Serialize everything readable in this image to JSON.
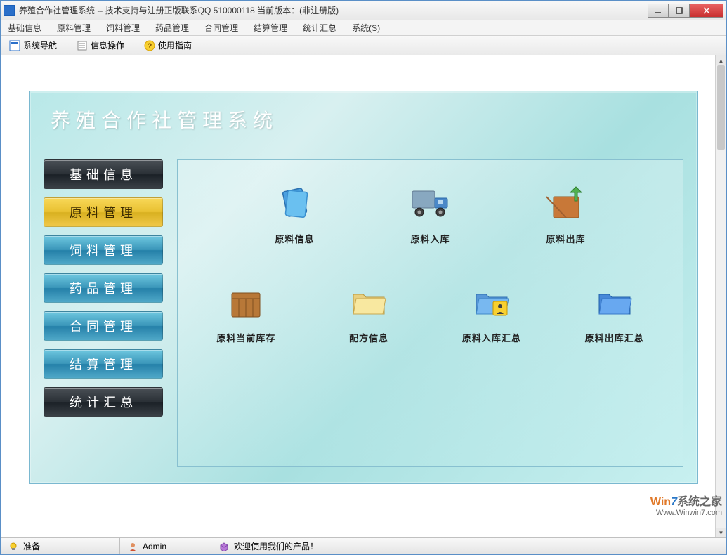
{
  "window": {
    "title": "养殖合作社管理系统 -- 技术支持与注册正版联系QQ 510000118    当前版本：(非注册版)"
  },
  "menubar": {
    "items": [
      "基础信息",
      "原料管理",
      "饲料管理",
      "药品管理",
      "合同管理",
      "结算管理",
      "统计汇总",
      "系统(S)"
    ]
  },
  "toolbar": {
    "nav_label": "系统导航",
    "info_label": "信息操作",
    "guide_label": "使用指南"
  },
  "panel": {
    "title": "养殖合作社管理系统"
  },
  "sidebar": {
    "items": [
      {
        "label": "基础信息",
        "style": "dark"
      },
      {
        "label": "原料管理",
        "style": "active"
      },
      {
        "label": "饲料管理",
        "style": "normal"
      },
      {
        "label": "药品管理",
        "style": "normal"
      },
      {
        "label": "合同管理",
        "style": "normal"
      },
      {
        "label": "结算管理",
        "style": "normal"
      },
      {
        "label": "统计汇总",
        "style": "dark"
      }
    ]
  },
  "icons_row1": [
    {
      "label": "原料信息",
      "icon": "doc-icon"
    },
    {
      "label": "原料入库",
      "icon": "truck-icon"
    },
    {
      "label": "原料出库",
      "icon": "box-up-icon"
    }
  ],
  "icons_row2": [
    {
      "label": "原料当前库存",
      "icon": "crate-icon"
    },
    {
      "label": "配方信息",
      "icon": "folder-icon"
    },
    {
      "label": "原料入库汇总",
      "icon": "folder-person-icon"
    },
    {
      "label": "原料出库汇总",
      "icon": "folder-blue-icon"
    }
  ],
  "statusbar": {
    "ready": "准备",
    "user": "Admin",
    "welcome": "欢迎使用我们的产品！"
  },
  "watermark": {
    "line1_a": "Win",
    "line1_b": "7",
    "line1_c": "系统之家",
    "line2": "Www.Winwin7.com"
  }
}
